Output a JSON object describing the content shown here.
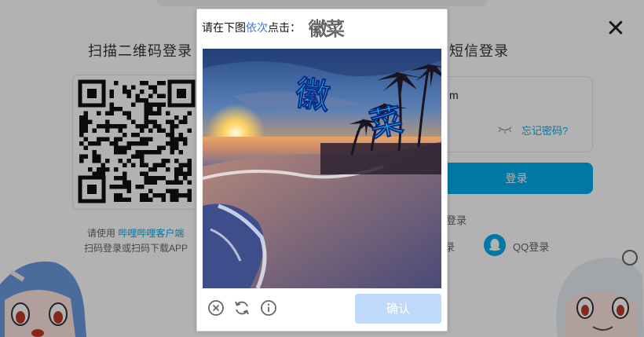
{
  "page": {
    "qr_title": "扫描二维码登录",
    "sms_title": "短信登录",
    "qr_hint_prefix": "请使用",
    "qr_hint_link": "哔哩哔哩客户端",
    "qr_hint_line2": "扫码登录或扫码下载APP",
    "sms_input_value": "m",
    "forgot_password": "忘记密码?",
    "login_button": "登录",
    "sms_register_partial": "登录",
    "sms_other_partial": "录",
    "qq_login": "QQ登录",
    "close_icon": "✕",
    "accent_color": "#00aeec"
  },
  "captcha": {
    "instruction_prefix": "请在下图",
    "instruction_highlight": "依次",
    "instruction_suffix": "点击：",
    "target_chars": "徽菜",
    "image_chars": [
      "徽",
      "菜"
    ],
    "confirm_label": "确认",
    "tools": [
      "close-circle-icon",
      "refresh-icon",
      "info-icon"
    ],
    "confirm_color": "#bfd9fb"
  }
}
